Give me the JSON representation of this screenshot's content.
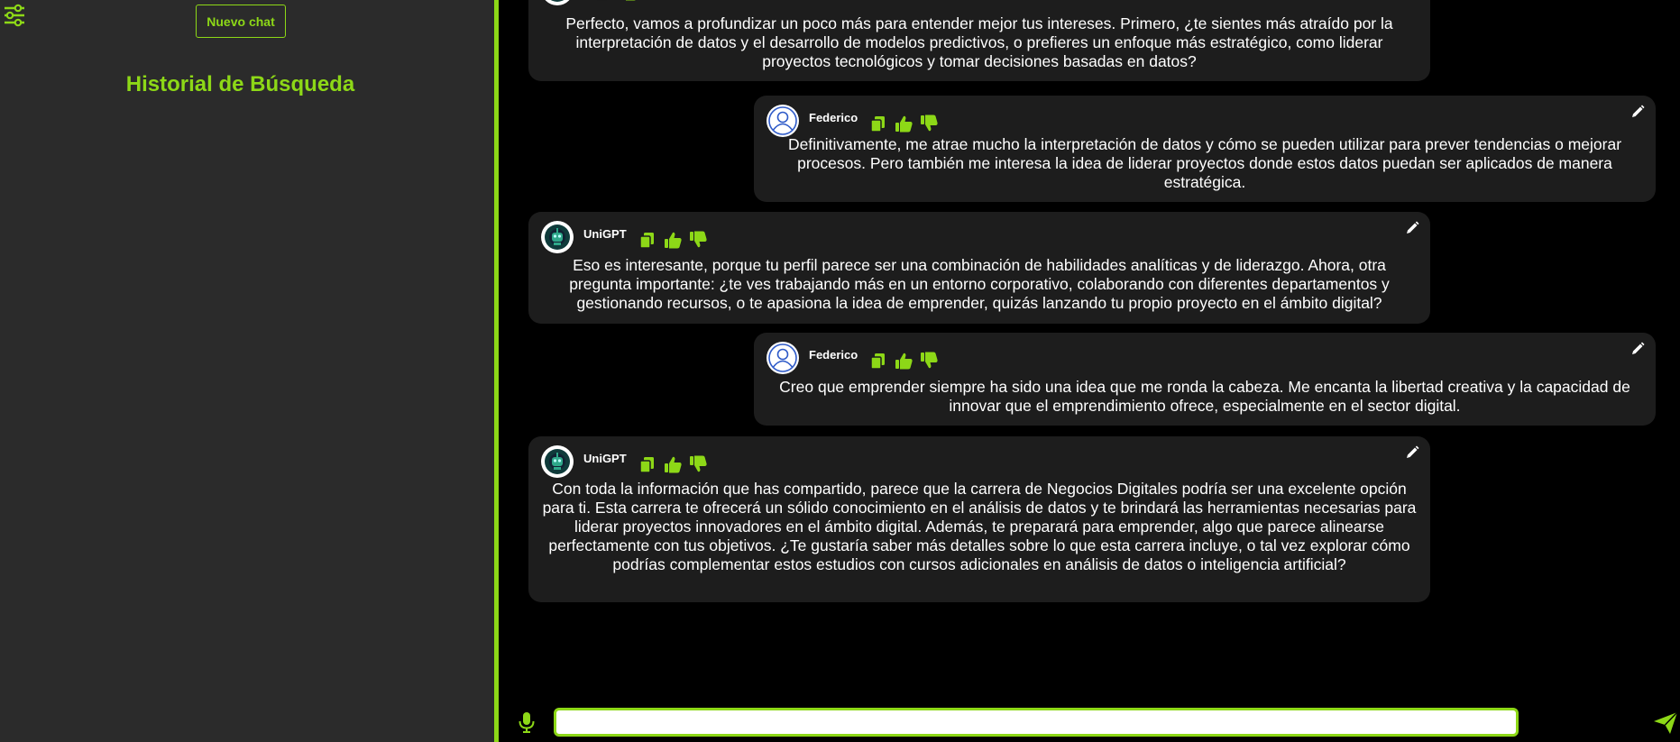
{
  "sidebar": {
    "new_chat_label": "Nuevo chat",
    "history_title": "Historial de Búsqueda"
  },
  "messages": [
    {
      "sender": "",
      "role": "bot",
      "text": "Perfecto, vamos a profundizar un poco más para entender mejor tus intereses. Primero, ¿te sientes más atraído por la interpretación de datos y el desarrollo de modelos predictivos, o prefieres un enfoque más estratégico, como liderar proyectos tecnológicos y tomar decisiones basadas en datos?"
    },
    {
      "sender": "Federico",
      "role": "user",
      "text": "Definitivamente, me atrae mucho la interpretación de datos y cómo se pueden utilizar para prever tendencias o mejorar procesos. Pero también me interesa la idea de liderar proyectos donde estos datos puedan ser aplicados de manera estratégica."
    },
    {
      "sender": "UniGPT",
      "role": "bot",
      "text": "Eso es interesante, porque tu perfil parece ser una combinación de habilidades analíticas y de liderazgo. Ahora, otra pregunta importante: ¿te ves trabajando más en un entorno corporativo, colaborando con diferentes departamentos y gestionando recursos, o te apasiona la idea de emprender, quizás lanzando tu propio proyecto en el ámbito digital?"
    },
    {
      "sender": "Federico",
      "role": "user",
      "text": "Creo que emprender siempre ha sido una idea que me ronda la cabeza. Me encanta la libertad creativa y la capacidad de innovar que el emprendimiento ofrece, especialmente en el sector digital."
    },
    {
      "sender": "UniGPT",
      "role": "bot",
      "text": "Con toda la información que has compartido, parece que la carrera de Negocios Digitales podría ser una excelente opción para ti. Esta carrera te ofrecerá un sólido conocimiento en el análisis de datos y te brindará las herramientas necesarias para liderar proyectos innovadores en el ámbito digital. Además, te preparará para emprender, algo que parece alinearse perfectamente con tus objetivos. ¿Te gustaría saber más detalles sobre lo que esta carrera incluye, o tal vez explorar cómo podrías complementar estos estudios con cursos adicionales en análisis de datos o inteligencia artificial?"
    }
  ],
  "input": {
    "value": "",
    "placeholder": ""
  },
  "colors": {
    "accent": "#8dd817",
    "sidebar_bg": "#2b2b2b",
    "bubble_bg": "#1d1d1d",
    "chat_bg": "#000000",
    "user_avatar_ring": "#2e5ac8",
    "bot_avatar_bg": "#0f3b3b"
  },
  "icons": {
    "settings": "sliders-icon",
    "copy": "copy-icon",
    "like": "thumbs-up-icon",
    "dislike": "thumbs-down-icon",
    "edit": "pencil-icon",
    "mic": "microphone-icon",
    "send": "send-icon"
  }
}
